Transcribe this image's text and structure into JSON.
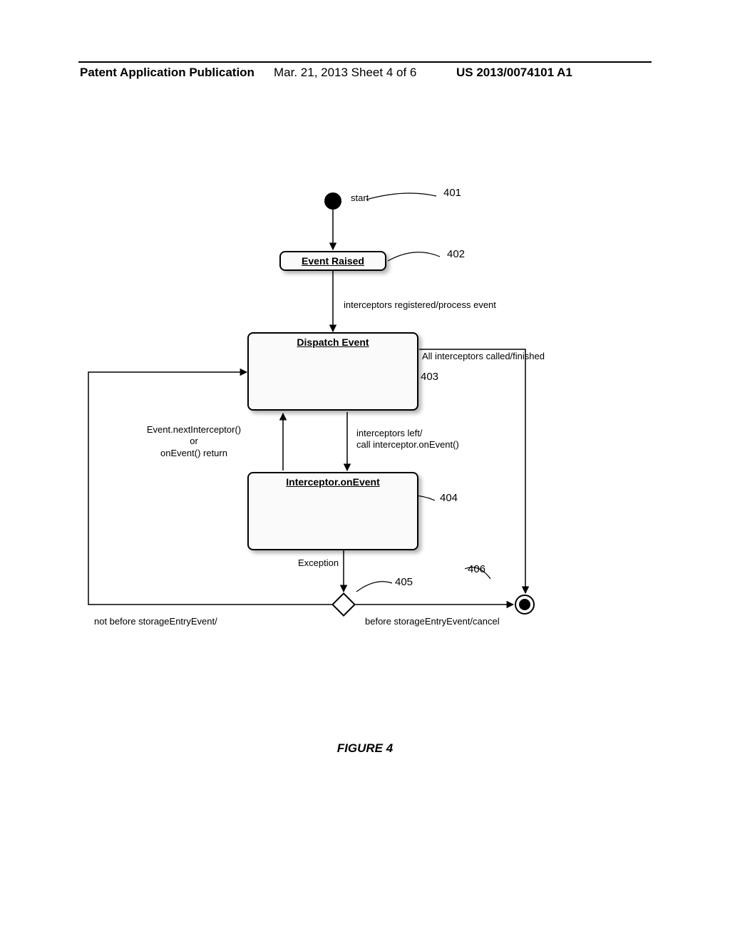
{
  "header": {
    "left": "Patent Application Publication",
    "center": "Mar. 21, 2013  Sheet 4 of 6",
    "right": "US 2013/0074101 A1"
  },
  "figure_label": "FIGURE 4",
  "nodes": {
    "start": {
      "label": "start",
      "ref": "401"
    },
    "event_raised": {
      "title": "Event Raised",
      "ref": "402"
    },
    "dispatch_event": {
      "title": "Dispatch Event",
      "ref": "403"
    },
    "interceptor_on_event": {
      "title": "Interceptor.onEvent",
      "ref": "404"
    },
    "decision": {
      "ref": "405"
    },
    "end": {
      "ref": "406"
    }
  },
  "edges": {
    "start_to_raised": "",
    "raised_to_dispatch": "interceptors registered/process event",
    "dispatch_to_end": "All interceptors called/finished",
    "dispatch_to_onEvent": "interceptors left/\ncall interceptor.onEvent()",
    "onEvent_to_dispatch": "Event.nextInterceptor()\nor\nonEvent() return",
    "onEvent_to_decision": "Exception",
    "decision_to_end": "before storageEntryEvent/cancel",
    "decision_to_dispatch": "not before storageEntryEvent/"
  },
  "chart_data": {
    "type": "state-diagram",
    "title": "FIGURE 4",
    "initial": "start",
    "final": "end",
    "states": [
      {
        "id": "start",
        "kind": "initial",
        "label": "start",
        "ref": "401"
      },
      {
        "id": "event_raised",
        "kind": "simple",
        "label": "Event Raised",
        "ref": "402"
      },
      {
        "id": "dispatch_event",
        "kind": "composite",
        "label": "Dispatch Event",
        "ref": "403"
      },
      {
        "id": "interceptor_on_event",
        "kind": "composite",
        "label": "Interceptor.onEvent",
        "ref": "404"
      },
      {
        "id": "decision",
        "kind": "choice",
        "ref": "405"
      },
      {
        "id": "end",
        "kind": "final",
        "ref": "406"
      }
    ],
    "transitions": [
      {
        "from": "start",
        "to": "event_raised",
        "label": ""
      },
      {
        "from": "event_raised",
        "to": "dispatch_event",
        "label": "interceptors registered/process event"
      },
      {
        "from": "dispatch_event",
        "to": "end",
        "label": "All interceptors called/finished"
      },
      {
        "from": "dispatch_event",
        "to": "interceptor_on_event",
        "label": "interceptors left/call interceptor.onEvent()"
      },
      {
        "from": "interceptor_on_event",
        "to": "dispatch_event",
        "label": "Event.nextInterceptor() or onEvent() return"
      },
      {
        "from": "interceptor_on_event",
        "to": "decision",
        "label": "Exception"
      },
      {
        "from": "decision",
        "to": "end",
        "label": "before storageEntryEvent/cancel"
      },
      {
        "from": "decision",
        "to": "dispatch_event",
        "label": "not before storageEntryEvent/"
      }
    ]
  }
}
